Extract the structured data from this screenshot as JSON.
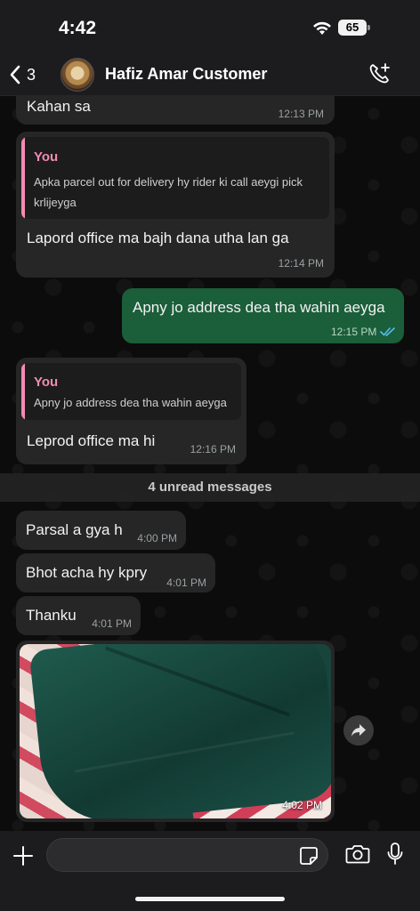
{
  "status_bar": {
    "time": "4:42",
    "battery": "65"
  },
  "header": {
    "back_count": "3",
    "contact_name": "Hafiz Amar Customer"
  },
  "messages": [
    {
      "type": "in",
      "text": "Kahan sa",
      "time": "12:13 PM"
    },
    {
      "type": "in",
      "quote_author": "You",
      "quote_text": "Apka parcel out for delivery hy rider ki call aeygi pick krlijeyga",
      "text": "Lapord office ma bajh dana utha lan ga",
      "time": "12:14 PM"
    },
    {
      "type": "out",
      "text": "Apny jo address dea tha wahin aeyga",
      "time": "12:15 PM",
      "status": "read"
    },
    {
      "type": "in",
      "quote_author": "You",
      "quote_text": "Apny jo address dea tha wahin aeyga",
      "text": "Leprod office ma hi",
      "time": "12:16 PM"
    },
    {
      "type": "in",
      "text": "Parsal a gya h",
      "time": "4:00 PM"
    },
    {
      "type": "in",
      "text": "Bhot acha hy kpry",
      "time": "4:01 PM"
    },
    {
      "type": "in",
      "text": "Thanku",
      "time": "4:01 PM"
    },
    {
      "type": "in-image",
      "time": "4:02 PM"
    }
  ],
  "unread_banner": "4 unread messages",
  "composer": {
    "placeholder": ""
  },
  "icons": {
    "back": "chevron-left-icon",
    "call_add": "phone-plus-icon",
    "forward": "forward-icon",
    "plus": "plus-icon",
    "sticker": "sticker-icon",
    "camera": "camera-icon",
    "mic": "microphone-icon"
  },
  "colors": {
    "outgoing_bubble": "#1b5e3a",
    "incoming_bubble": "#262626",
    "quote_accent": "#f28bb3",
    "read_ticks": "#53bdeb"
  }
}
